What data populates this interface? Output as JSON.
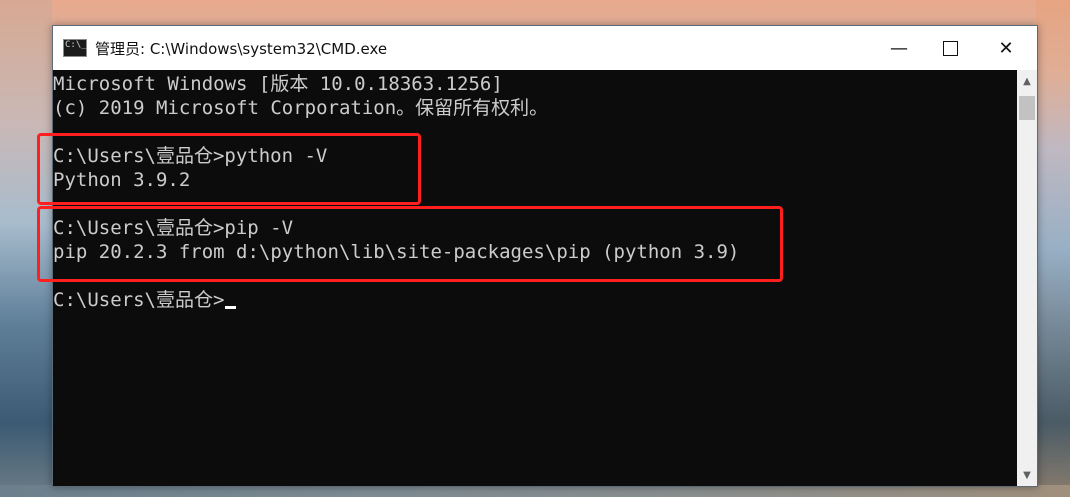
{
  "window": {
    "title": "管理员: C:\\Windows\\system32\\CMD.exe",
    "controls": {
      "minimize": "—",
      "maximize": "",
      "close": "✕"
    }
  },
  "console": {
    "lines": [
      "Microsoft Windows [版本 10.0.18363.1256]",
      "(c) 2019 Microsoft Corporation。保留所有权利。",
      "",
      "C:\\Users\\壹品仓>python -V",
      "Python 3.9.2",
      "",
      "C:\\Users\\壹品仓>pip -V",
      "pip 20.2.3 from d:\\python\\lib\\site-packages\\pip (python 3.9)",
      "",
      "C:\\Users\\壹品仓>"
    ]
  },
  "scrollbar": {
    "up_icon": "▲",
    "down_icon": "▼"
  },
  "colors": {
    "console_bg": "#0c0c0c",
    "console_text": "#cccccc",
    "highlight": "#ff1f1f",
    "titlebar_bg": "#ffffff"
  }
}
